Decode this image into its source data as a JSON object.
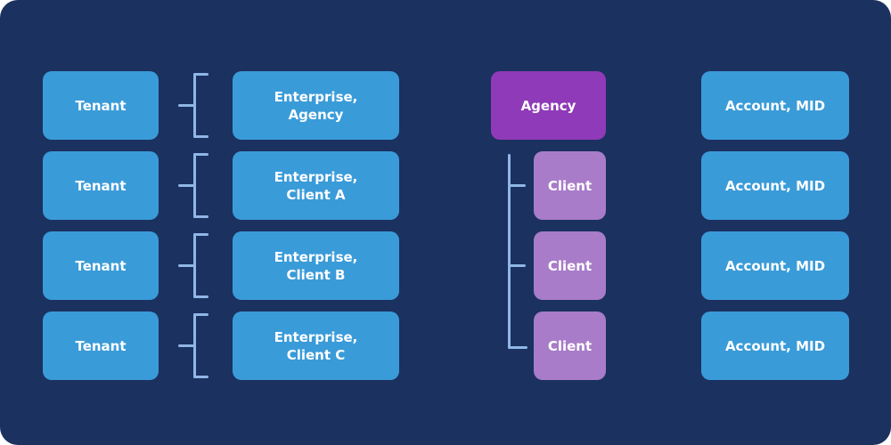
{
  "diagram": {
    "colors": {
      "background": "#1b3160",
      "blue_box": "#3a9bd9",
      "agency_box": "#8f3ab8",
      "client_box": "#a87cc9",
      "connector": "#8fb6e6",
      "text": "#ffffff"
    },
    "tenants": [
      "Tenant",
      "Tenant",
      "Tenant",
      "Tenant"
    ],
    "enterprises": [
      {
        "line1": "Enterprise,",
        "line2": "Agency"
      },
      {
        "line1": "Enterprise,",
        "line2": "Client A"
      },
      {
        "line1": "Enterprise,",
        "line2": "Client B"
      },
      {
        "line1": "Enterprise,",
        "line2": "Client C"
      }
    ],
    "agency": "Agency",
    "clients": [
      "Client",
      "Client",
      "Client"
    ],
    "accounts": [
      "Account, MID",
      "Account, MID",
      "Account, MID",
      "Account, MID"
    ]
  }
}
